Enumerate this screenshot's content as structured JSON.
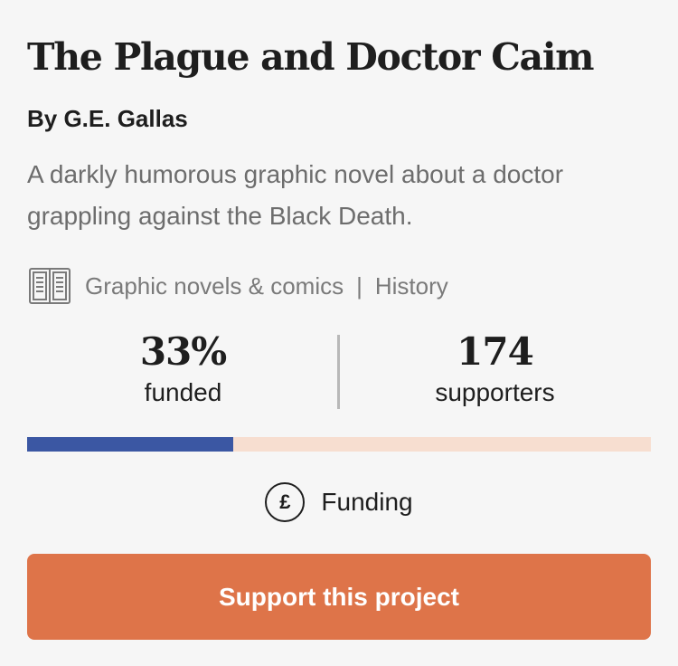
{
  "project": {
    "title": "The Plague and Doctor Caim",
    "author": "By G.E. Gallas",
    "description": "A darkly humorous graphic novel about a doctor grappling against the Black Death.",
    "categories": [
      "Graphic novels & comics",
      "History"
    ],
    "category_separator": "|",
    "category_icon": "book-icon"
  },
  "stats": {
    "funded_value": "33%",
    "funded_label": "funded",
    "supporters_value": "174",
    "supporters_label": "supporters",
    "progress_fraction": 0.33
  },
  "funding": {
    "icon": "pound-icon",
    "symbol": "£",
    "label": "Funding"
  },
  "cta": {
    "label": "Support this project"
  },
  "colors": {
    "accent": "#de7449",
    "progress_fill": "#3b57a3",
    "progress_track": "#f7ded0",
    "background": "#f6f6f6"
  }
}
